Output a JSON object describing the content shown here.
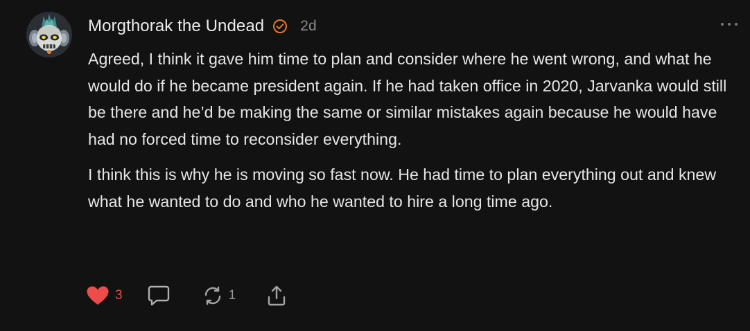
{
  "comment": {
    "author": "Morgthorak the Undead",
    "time": "2d",
    "avatar_icon": "skull-knight-avatar",
    "badge_icon": "check-circle-icon",
    "badge_color": "#e8782d",
    "paragraphs": [
      "Agreed, I think it gave him time to plan and consider where he went wrong, and what he would do if he became president again. If he had taken office in 2020, Jarvanka would still be there and he’d be making the same or similar mistakes again because he would have had no forced time to reconsider everything.",
      "I think this is why he is moving so fast now. He had time to plan everything out and knew what he wanted to do and who he wanted to hire a long time ago."
    ]
  },
  "actions": {
    "like_icon": "heart-icon",
    "like_count": "3",
    "like_color": "#ee4b4b",
    "reply_icon": "comment-bubble-icon",
    "restack_icon": "restack-icon",
    "restack_count": "1",
    "share_icon": "share-icon",
    "more_icon": "more-dots-icon"
  }
}
